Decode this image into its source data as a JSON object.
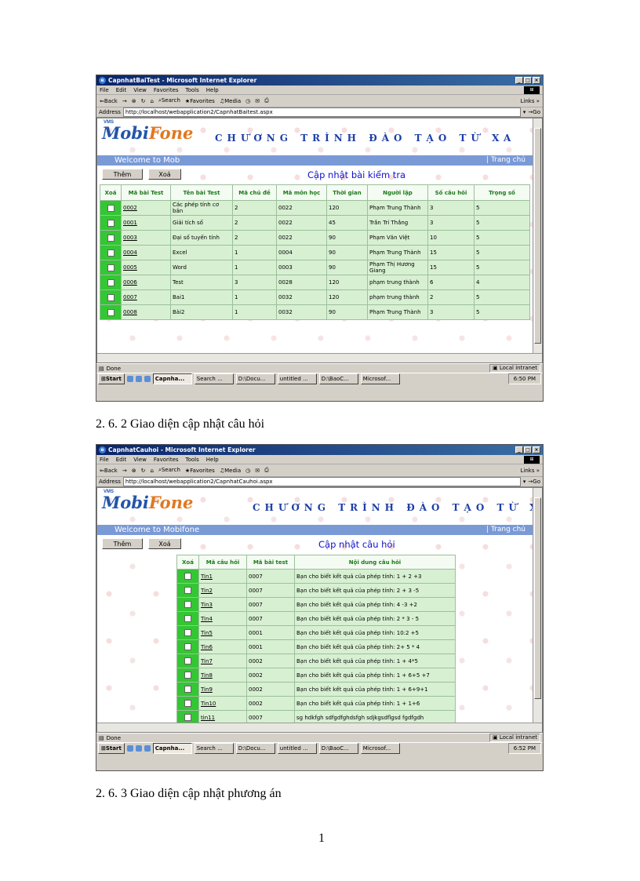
{
  "screenshot1": {
    "window_title": "CapnhatBaiTest - Microsoft Internet Explorer",
    "menu": [
      "File",
      "Edit",
      "View",
      "Favorites",
      "Tools",
      "Help"
    ],
    "links_label": "Links »",
    "toolbar": {
      "back": "⇐Back",
      "forward": "→",
      "search": "Search",
      "favorites": "Favorites",
      "media": "Media"
    },
    "address_label": "Address",
    "address_url": "http://localhost/webapplication2/CapnhatBaitest.aspx",
    "go_label": "Go",
    "logo": {
      "vms": "VMS",
      "part1": "Mobi",
      "part2": "Fone"
    },
    "banner_title": "CHƯƠNG TRÌNH ĐÀO TẠO TỪ XA",
    "welcome": "Welcome to Mob",
    "trang_chu": "| Trang chủ",
    "btn_them": "Thêm",
    "btn_xoa": "Xoá",
    "heading": "Cập nhật bài kiểm tra",
    "columns": [
      "Xoá",
      "Mã bài Test",
      "Tên bài Test",
      "Mã chủ đề",
      "Mã môn học",
      "Thời gian",
      "Người lập",
      "Số câu hỏi",
      "Trọng số"
    ],
    "rows": [
      {
        "ma": "0002",
        "ten": "Các phép tính cơ bản",
        "chude": "2",
        "monhoc": "0022",
        "thoigian": "120",
        "nguoilap": "Phạm Trung Thành",
        "socauhoi": "3",
        "trongso": "5"
      },
      {
        "ma": "0001",
        "ten": "Giải tích số",
        "chude": "2",
        "monhoc": "0022",
        "thoigian": "45",
        "nguoilap": "Trần Trí Thắng",
        "socauhoi": "3",
        "trongso": "5"
      },
      {
        "ma": "0003",
        "ten": "Đại số tuyến tính",
        "chude": "2",
        "monhoc": "0022",
        "thoigian": "90",
        "nguoilap": "Phạm Văn Việt",
        "socauhoi": "10",
        "trongso": "5"
      },
      {
        "ma": "0004",
        "ten": "Excel",
        "chude": "1",
        "monhoc": "0004",
        "thoigian": "90",
        "nguoilap": "Phạm Trung Thành",
        "socauhoi": "15",
        "trongso": "5"
      },
      {
        "ma": "0005",
        "ten": "Word",
        "chude": "1",
        "monhoc": "0003",
        "thoigian": "90",
        "nguoilap": "Phạm Thị Hương Giang",
        "socauhoi": "15",
        "trongso": "5"
      },
      {
        "ma": "0006",
        "ten": "Test",
        "chude": "3",
        "monhoc": "0028",
        "thoigian": "120",
        "nguoilap": "phạm trung thành",
        "socauhoi": "6",
        "trongso": "4"
      },
      {
        "ma": "0007",
        "ten": "Bai1",
        "chude": "1",
        "monhoc": "0032",
        "thoigian": "120",
        "nguoilap": "phạm trung thành",
        "socauhoi": "2",
        "trongso": "5"
      },
      {
        "ma": "0008",
        "ten": "Bài2",
        "chude": "1",
        "monhoc": "0032",
        "thoigian": "90",
        "nguoilap": "Phạm Trung Thành",
        "socauhoi": "3",
        "trongso": "5"
      }
    ],
    "status_left": "Done",
    "status_zone": "Local intranet",
    "taskbar": {
      "start": "Start",
      "tasks": [
        "Capnha...",
        "Search ...",
        "D:\\Docu...",
        "untitled ...",
        "D:\\BaoC...",
        "Microsof..."
      ],
      "clock": "6:50 PM"
    }
  },
  "caption1": "2. 6. 2 Giao diện cập nhật câu hỏi",
  "screenshot2": {
    "window_title": "CapnhatCauhoi - Microsoft Internet Explorer",
    "menu": [
      "File",
      "Edit",
      "View",
      "Favorites",
      "Tools",
      "Help"
    ],
    "links_label": "Links »",
    "toolbar": {
      "back": "⇐Back",
      "forward": "→",
      "search": "Search",
      "favorites": "Favorites",
      "media": "Media"
    },
    "address_label": "Address",
    "address_url": "http://localhost/webapplication2/CapnhatCauhoi.aspx",
    "go_label": "Go",
    "logo": {
      "vms": "VMS",
      "part1": "Mobi",
      "part2": "Fone"
    },
    "banner_title": "CHƯƠNG TRÌNH ĐÀO TẠO TỪ XA",
    "welcome": "Welcome to Mobifone",
    "trang_chu": "| Trang chủ",
    "btn_them": "Thêm",
    "btn_xoa": "Xoá",
    "heading": "Cập nhật câu hỏi",
    "columns": [
      "Xoá",
      "Mã câu hỏi",
      "Mã bài test",
      "Nội dung câu hỏi"
    ],
    "rows": [
      {
        "ma": "Tin1",
        "bai": "0007",
        "noidung": "Bạn cho biết kết quả của phép tính: 1 + 2 +3"
      },
      {
        "ma": "Tin2",
        "bai": "0007",
        "noidung": "Bạn cho biết kết quả của phép tính: 2 + 3 -5"
      },
      {
        "ma": "Tin3",
        "bai": "0007",
        "noidung": "Bạn cho biết kết quả của phép tính: 4 -3 +2"
      },
      {
        "ma": "Tin4",
        "bai": "0007",
        "noidung": "Bạn cho biết kết quả của phép tính: 2 * 3 - 5"
      },
      {
        "ma": "Tin5",
        "bai": "0001",
        "noidung": "Bạn cho biết kết quả của phép tính: 10:2 +5"
      },
      {
        "ma": "Tin6",
        "bai": "0001",
        "noidung": "Bạn cho biết kết quả của phép tính: 2+ 5 * 4"
      },
      {
        "ma": "Tin7",
        "bai": "0002",
        "noidung": "Bạn cho biết kết quả của phép tính: 1 + 4*5"
      },
      {
        "ma": "Tin8",
        "bai": "0002",
        "noidung": "Bạn cho biết kết quả của phép tính: 1 + 6+5 +7"
      },
      {
        "ma": "Tin9",
        "bai": "0002",
        "noidung": "Bạn cho biết kết quả của phép tính: 1 + 6+9+1"
      },
      {
        "ma": "Tin10",
        "bai": "0002",
        "noidung": "Bạn cho biết kết quả của phép tính: 1 + 1+6"
      },
      {
        "ma": "tin11",
        "bai": "0007",
        "noidung": "sg hdkfgh sdfgdfghdsfgh sdjkgsdflgsd fgdfgdh"
      }
    ],
    "status_left": "Done",
    "status_zone": "Local intranet",
    "taskbar": {
      "start": "Start",
      "tasks": [
        "Capnha...",
        "Search ...",
        "D:\\Docu...",
        "untitled ...",
        "D:\\BaoC...",
        "Microsof..."
      ],
      "clock": "6:52 PM"
    }
  },
  "caption2": "2. 6. 3 Giao diện cập nhật phương án",
  "page_number": "1"
}
